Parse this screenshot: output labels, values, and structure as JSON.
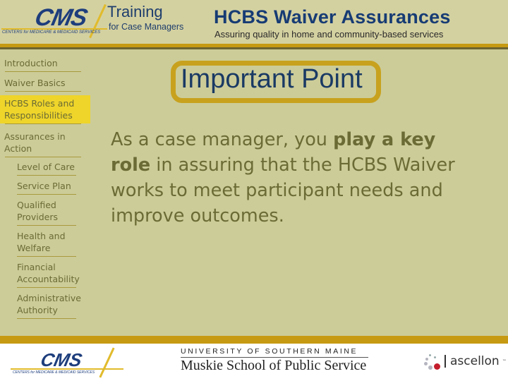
{
  "header": {
    "cms_logo": "CMS",
    "cms_subtitle": "CENTERS for MEDICARE & MEDICAID SERVICES",
    "training_title": "Training",
    "training_subtitle": "for Case Managers",
    "course_title": "HCBS Waiver Assurances",
    "course_subtitle": "Assuring quality in home and community-based services"
  },
  "sidebar": {
    "items": [
      {
        "label": "Introduction",
        "level": 1,
        "active": false
      },
      {
        "label": "Waiver Basics",
        "level": 1,
        "active": false
      },
      {
        "label": "HCBS Roles and Responsibilities",
        "level": 1,
        "active": true
      },
      {
        "label": "Assurances in Action",
        "level": 1,
        "active": false
      },
      {
        "label": "Level of Care",
        "level": 2,
        "active": false
      },
      {
        "label": "Service Plan",
        "level": 2,
        "active": false
      },
      {
        "label": "Qualified Providers",
        "level": 2,
        "active": false
      },
      {
        "label": "Health and Welfare",
        "level": 2,
        "active": false
      },
      {
        "label": "Financial Accountability",
        "level": 2,
        "active": false
      },
      {
        "label": "Administrative Authority",
        "level": 2,
        "active": false
      }
    ]
  },
  "main": {
    "callout_title": "Important Point",
    "body_prefix": "As a case manager, you ",
    "body_bold": "play a key role",
    "body_suffix": " in assuring that the HCBS Waiver works to meet participant needs and improve outcomes."
  },
  "footer": {
    "cms_logo": "CMS",
    "cms_subtitle": "CENTERS for MEDICARE & MEDICAID SERVICES",
    "usm_line1": "UNIVERSITY OF SOUTHERN MAINE",
    "usm_line2": "Muskie School of Public Service",
    "ascellon": "ascellon",
    "ascellon_tm": "™"
  },
  "colors": {
    "background": "#cccc99",
    "accent_gold": "#c69a12",
    "active_nav": "#efd52a",
    "title_blue": "#173c74",
    "body_olive": "#6b6b35"
  }
}
